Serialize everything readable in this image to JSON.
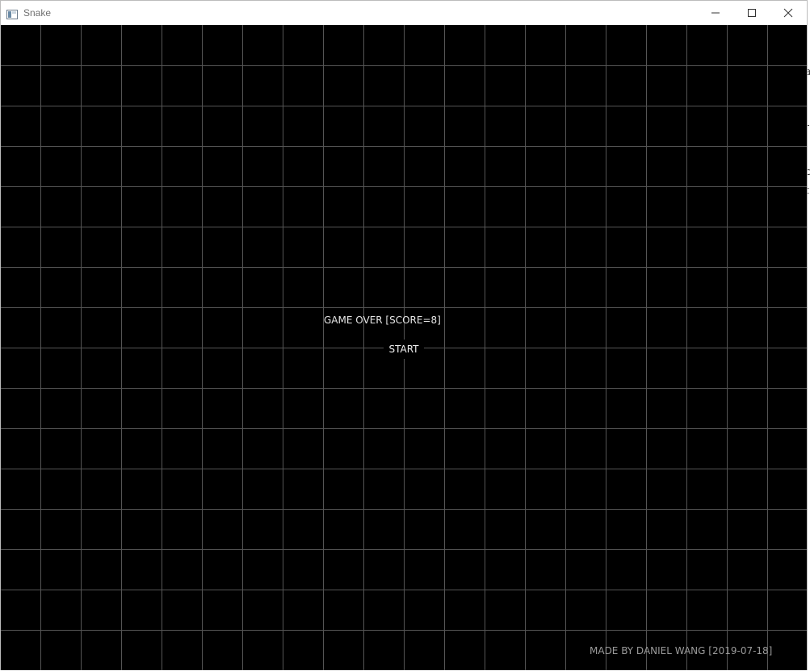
{
  "window": {
    "title": "Snake"
  },
  "icons": {
    "app": "app-window-icon",
    "minimize": "minimize-icon",
    "maximize": "maximize-icon",
    "close": "close-icon"
  },
  "game": {
    "status_text": "GAME OVER [SCORE=8]",
    "score": 8,
    "start_label": "START",
    "credit": "MADE BY DANIEL WANG [2019-07-18]"
  },
  "background_window": {
    "edge_glyphs": [
      "a",
      "r",
      "c",
      "t"
    ]
  },
  "colors": {
    "board_background": "#000000",
    "grid_lines": "#555555",
    "text": "#e6e6e6"
  }
}
